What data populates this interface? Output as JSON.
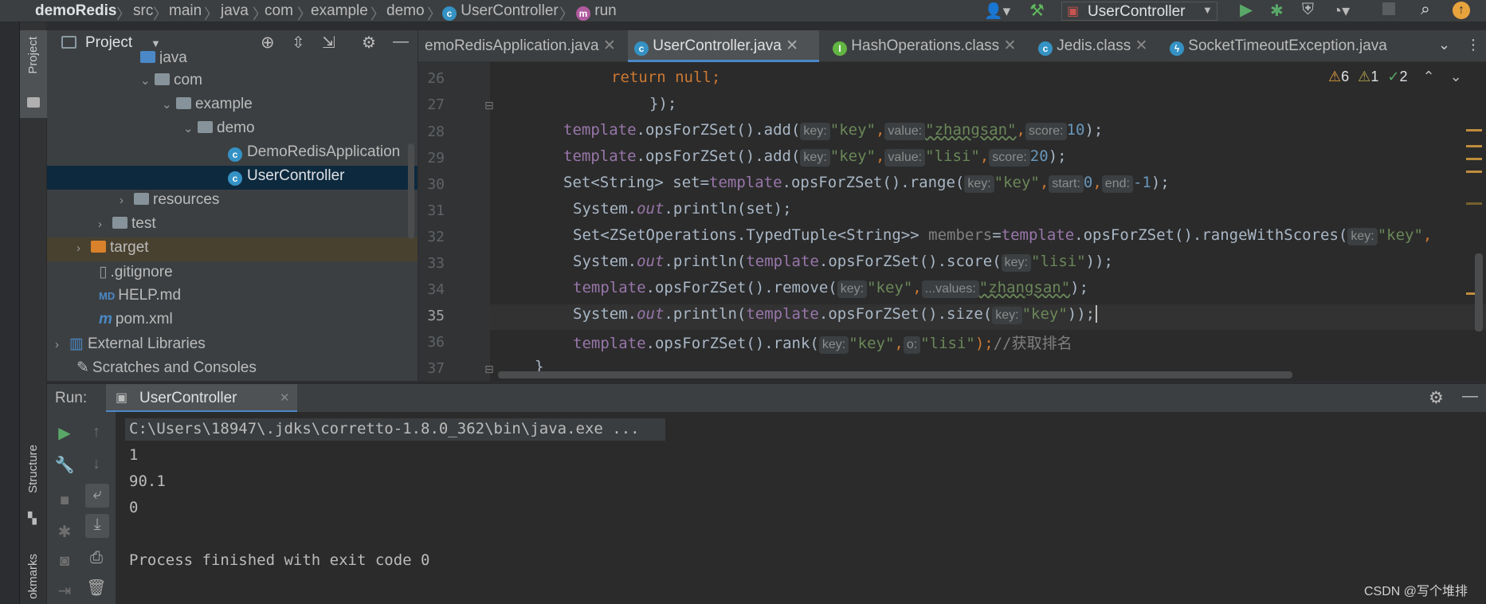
{
  "breadcrumbs": [
    "demoRedis",
    "src",
    "main",
    "java",
    "com",
    "example",
    "demo",
    "UserController",
    "run"
  ],
  "toolbar": {
    "run_config": "UserController"
  },
  "project_panel": {
    "title": "Project",
    "tree": [
      {
        "label": "java",
        "type": "folder"
      },
      {
        "label": "com",
        "type": "package"
      },
      {
        "label": "example",
        "type": "package"
      },
      {
        "label": "demo",
        "type": "package"
      },
      {
        "label": "DemoRedisApplication",
        "type": "class"
      },
      {
        "label": "UserController",
        "type": "class"
      },
      {
        "label": "resources",
        "type": "folder"
      },
      {
        "label": "test",
        "type": "folder"
      },
      {
        "label": "target",
        "type": "folder"
      },
      {
        "label": ".gitignore",
        "type": "file"
      },
      {
        "label": "HELP.md",
        "type": "file"
      },
      {
        "label": "pom.xml",
        "type": "file"
      },
      {
        "label": "External Libraries",
        "type": "lib"
      },
      {
        "label": "Scratches and Consoles",
        "type": "lib"
      }
    ]
  },
  "editor_tabs": [
    {
      "label": "emoRedisApplication.java"
    },
    {
      "label": "UserController.java"
    },
    {
      "label": "HashOperations.class"
    },
    {
      "label": "Jedis.class"
    },
    {
      "label": "SocketTimeoutException.java"
    }
  ],
  "inspections": {
    "warnings": "6",
    "weak": "1",
    "ok": "2"
  },
  "code": {
    "line_numbers": [
      "26",
      "27",
      "28",
      "29",
      "30",
      "31",
      "32",
      "33",
      "34",
      "35",
      "36",
      "37"
    ],
    "hints": {
      "key": "key:",
      "value": "value:",
      "score": "score:",
      "start": "start:",
      "end": "end:",
      "values": "...values:",
      "o": "o:"
    },
    "strings": {
      "key": "\"key\"",
      "zhangsan": "\"zhangsan\"",
      "lisi": "\"lisi\""
    },
    "nums": {
      "n10": "10",
      "n20": "20",
      "n0": "0",
      "nm1": "-1"
    },
    "kw": {
      "return": "return",
      "null": "null"
    },
    "fld": {
      "template": "template",
      "members": "members",
      "out": "out"
    },
    "parts": {
      "close27": "});",
      "opsadd": ".opsForZSet().add(",
      "comma": ",",
      "close_semi": ");",
      "set_decl": "Set<String> set=",
      "range": ".opsForZSet().range(",
      "println_set": "System.",
      "println_set2": ".println(set);",
      "zset_decl": "Set<ZSetOperations.TypedTuple<String>> ",
      "eq": "=",
      "rangews": ".opsForZSet().rangeWithScores(",
      "sys": "System.",
      "println_open": ".println(",
      "score": ".opsForZSet().score(",
      "dclose": "));",
      "remove": ".opsForZSet().remove(",
      "size": ".opsForZSet().size(",
      "rank": ".opsForZSet().rank(",
      "semi_close": ");",
      "comment": "//获取排名",
      "brace": "}"
    }
  },
  "run_panel": {
    "label": "Run:",
    "tab": "UserController",
    "output": [
      "C:\\Users\\18947\\.jdks\\corretto-1.8.0_362\\bin\\java.exe ...",
      "1",
      "90.1",
      "0",
      "",
      "Process finished with exit code 0"
    ]
  },
  "side_labels": {
    "project": "Project",
    "structure": "Structure",
    "bookmarks": "okmarks"
  },
  "watermark": "CSDN @写个堆排"
}
